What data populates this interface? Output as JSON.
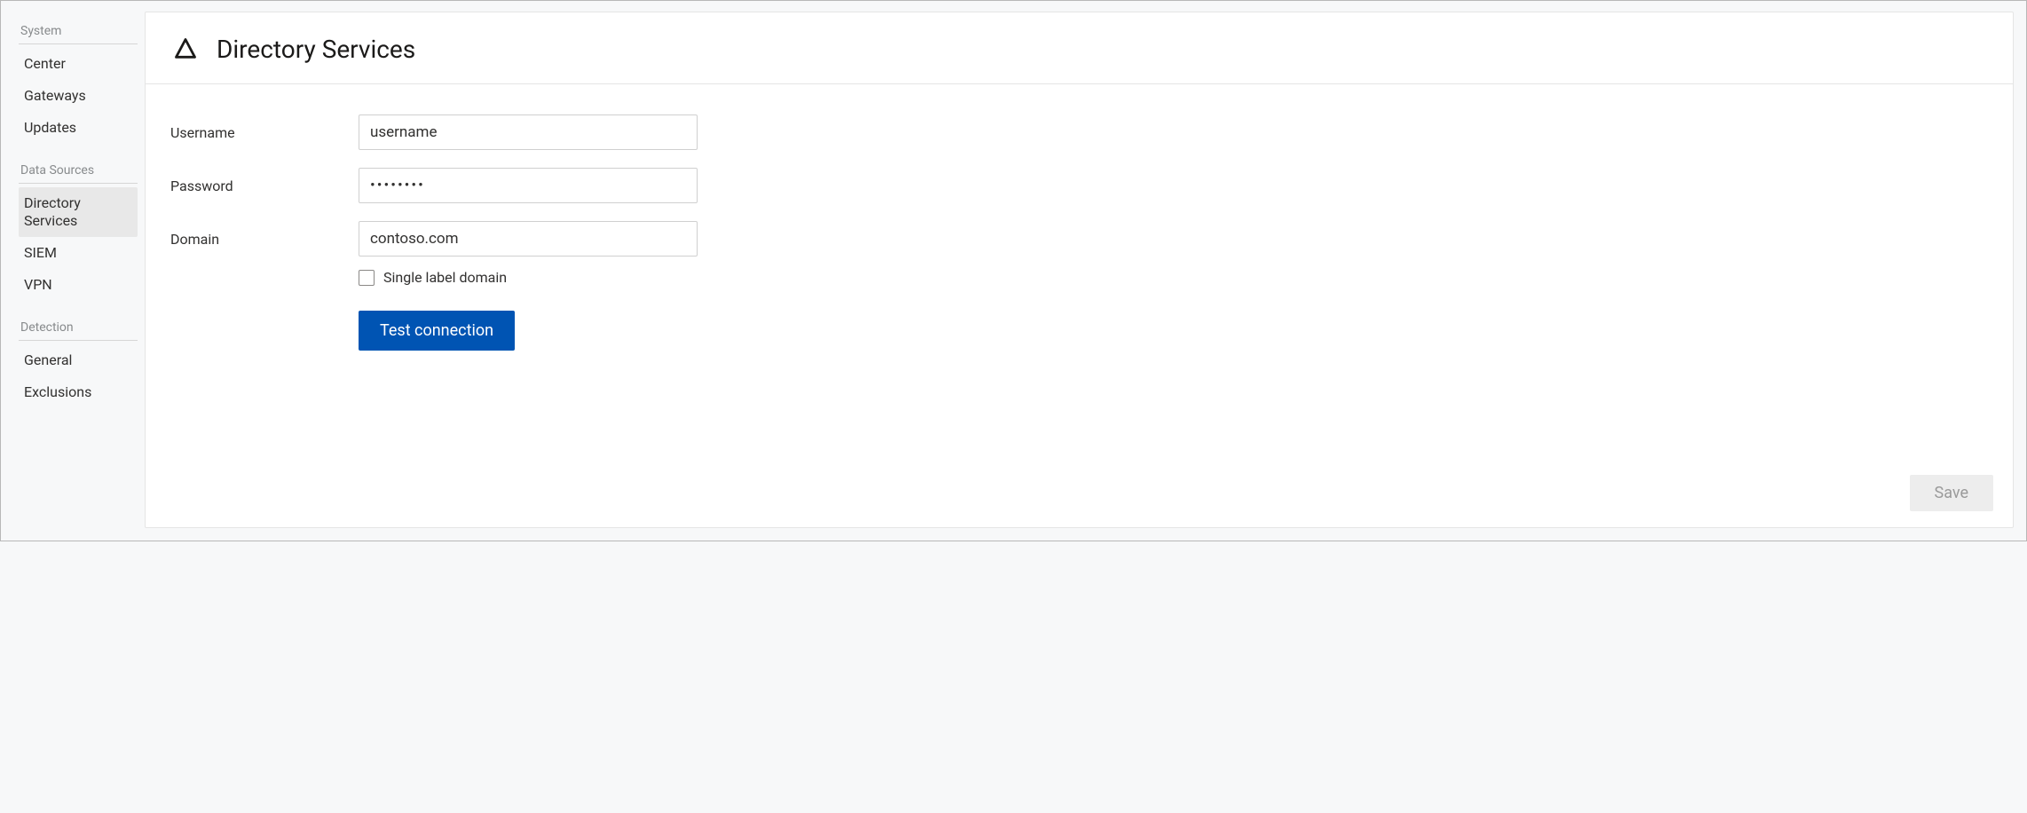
{
  "sidebar": {
    "groups": [
      {
        "header": "System",
        "items": [
          {
            "label": "Center",
            "name": "nav-center",
            "active": false
          },
          {
            "label": "Gateways",
            "name": "nav-gateways",
            "active": false
          },
          {
            "label": "Updates",
            "name": "nav-updates",
            "active": false
          }
        ]
      },
      {
        "header": "Data Sources",
        "items": [
          {
            "label": "Directory Services",
            "name": "nav-directory-services",
            "active": true
          },
          {
            "label": "SIEM",
            "name": "nav-siem",
            "active": false
          },
          {
            "label": "VPN",
            "name": "nav-vpn",
            "active": false
          }
        ]
      },
      {
        "header": "Detection",
        "items": [
          {
            "label": "General",
            "name": "nav-general",
            "active": false
          },
          {
            "label": "Exclusions",
            "name": "nav-exclusions",
            "active": false
          }
        ]
      }
    ]
  },
  "panel": {
    "title": "Directory Services",
    "form": {
      "username_label": "Username",
      "username_value": "username",
      "password_label": "Password",
      "password_value": "••••••••",
      "domain_label": "Domain",
      "domain_value": "contoso.com",
      "single_label_domain_label": "Single label domain",
      "single_label_domain_checked": false,
      "test_connection_label": "Test connection"
    },
    "save_label": "Save"
  }
}
